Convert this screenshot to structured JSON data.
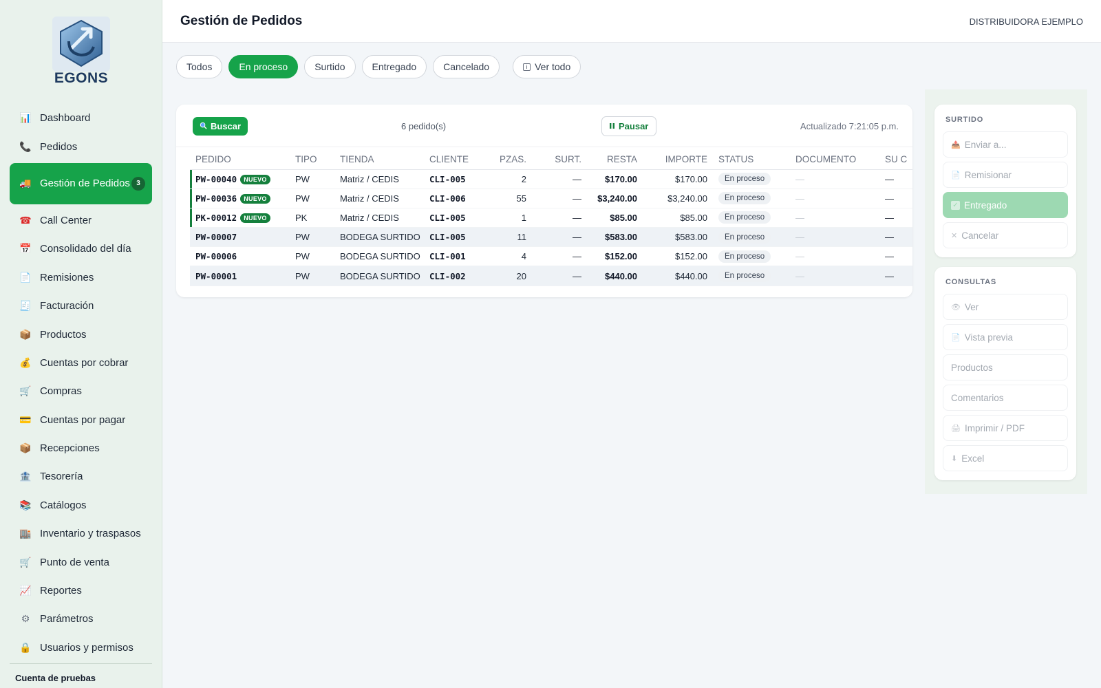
{
  "brand": {
    "name": "EGONS"
  },
  "header": {
    "title": "Gestión de Pedidos",
    "company": "DISTRIBUIDORA EJEMPLO"
  },
  "sidebar": {
    "items": [
      {
        "label": "Dashboard",
        "icon": "chart-icon"
      },
      {
        "label": "Pedidos",
        "icon": "phone-icon"
      },
      {
        "label": "Gestión de Pedidos",
        "icon": "truck-icon",
        "badge": "3",
        "active": true
      },
      {
        "label": "Call Center",
        "icon": "telephone-icon"
      },
      {
        "label": "Consolidado del día",
        "icon": "calendar-icon"
      },
      {
        "label": "Remisiones",
        "icon": "document-icon"
      },
      {
        "label": "Facturación",
        "icon": "receipt-icon"
      },
      {
        "label": "Productos",
        "icon": "box-icon"
      },
      {
        "label": "Cuentas por cobrar",
        "icon": "money-bag-icon"
      },
      {
        "label": "Compras",
        "icon": "cart-icon"
      },
      {
        "label": "Cuentas por pagar",
        "icon": "credit-card-icon"
      },
      {
        "label": "Recepciones",
        "icon": "package-icon"
      },
      {
        "label": "Tesorería",
        "icon": "bank-icon"
      },
      {
        "label": "Catálogos",
        "icon": "books-icon"
      },
      {
        "label": "Inventario y traspasos",
        "icon": "warehouse-icon"
      },
      {
        "label": "Punto de venta",
        "icon": "cart-icon"
      },
      {
        "label": "Reportes",
        "icon": "trend-icon"
      },
      {
        "label": "Parámetros",
        "icon": "gear-icon"
      },
      {
        "label": "Usuarios y permisos",
        "icon": "lock-icon"
      }
    ],
    "account": "Cuenta de pruebas"
  },
  "filters": [
    "Todos",
    "En proceso",
    "Surtido",
    "Entregado",
    "Cancelado"
  ],
  "filter_active": "En proceso",
  "view_all": "Ver todo",
  "toolbar": {
    "search_label": "Buscar",
    "count": "6 pedido(s)",
    "pause_label": "Pausar",
    "updated": "Actualizado 7:21:05 p.m."
  },
  "table": {
    "headers": [
      "PEDIDO",
      "TIPO",
      "TIENDA",
      "CLIENTE",
      "PZAS.",
      "SURT.",
      "RESTA",
      "IMPORTE",
      "STATUS",
      "DOCUMENTO",
      "SU C"
    ],
    "rows": [
      {
        "pedido": "PW-00040",
        "nuevo": "NUEVO",
        "tipo": "PW",
        "tienda": "Matriz / CEDIS",
        "cliente": "CLI-005",
        "pzas": "2",
        "surt": "—",
        "resta": "$170.00",
        "importe": "$170.00",
        "status": "En proceso",
        "documento": "—",
        "su": "—"
      },
      {
        "pedido": "PW-00036",
        "nuevo": "NUEVO",
        "tipo": "PW",
        "tienda": "Matriz / CEDIS",
        "cliente": "CLI-006",
        "pzas": "55",
        "surt": "—",
        "resta": "$3,240.00",
        "importe": "$3,240.00",
        "status": "En proceso",
        "documento": "—",
        "su": "—"
      },
      {
        "pedido": "PK-00012",
        "nuevo": "NUEVO",
        "tipo": "PK",
        "tienda": "Matriz / CEDIS",
        "cliente": "CLI-005",
        "pzas": "1",
        "surt": "—",
        "resta": "$85.00",
        "importe": "$85.00",
        "status": "En proceso",
        "documento": "—",
        "su": "—"
      },
      {
        "pedido": "PW-00007",
        "nuevo": "",
        "tipo": "PW",
        "tienda": "BODEGA SURTIDO",
        "cliente": "CLI-005",
        "pzas": "11",
        "surt": "—",
        "resta": "$583.00",
        "importe": "$583.00",
        "status": "En proceso",
        "documento": "—",
        "su": "—"
      },
      {
        "pedido": "PW-00006",
        "nuevo": "",
        "tipo": "PW",
        "tienda": "BODEGA SURTIDO",
        "cliente": "CLI-001",
        "pzas": "4",
        "surt": "—",
        "resta": "$152.00",
        "importe": "$152.00",
        "status": "En proceso",
        "documento": "—",
        "su": "—"
      },
      {
        "pedido": "PW-00001",
        "nuevo": "",
        "tipo": "PW",
        "tienda": "BODEGA SURTIDO",
        "cliente": "CLI-002",
        "pzas": "20",
        "surt": "—",
        "resta": "$440.00",
        "importe": "$440.00",
        "status": "En proceso",
        "documento": "—",
        "su": "—"
      }
    ]
  },
  "surtido": {
    "title": "SURTIDO",
    "actions": [
      {
        "label": "Enviar a...",
        "icon": "send-icon"
      },
      {
        "label": "Remisionar",
        "icon": "document-icon"
      },
      {
        "label": "Entregado",
        "icon": "check-icon"
      },
      {
        "label": "Cancelar",
        "icon": "close-icon"
      }
    ]
  },
  "consultas": {
    "title": "CONSULTAS",
    "actions": [
      {
        "label": "Ver",
        "icon": "eye-icon"
      },
      {
        "label": "Vista previa",
        "icon": "document-icon"
      },
      {
        "label": "Productos",
        "icon": ""
      },
      {
        "label": "Comentarios",
        "icon": ""
      },
      {
        "label": "Imprimir / PDF",
        "icon": "print-icon"
      },
      {
        "label": "Excel",
        "icon": "download-icon"
      }
    ]
  },
  "colors": {
    "accent": "#16a34a",
    "accent_dark": "#15803d",
    "disabled_green": "#9dd9b2"
  }
}
